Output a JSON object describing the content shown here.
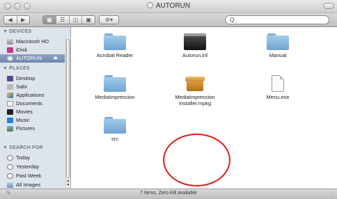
{
  "window": {
    "title": "AUTORUN"
  },
  "toolbar": {
    "back_glyph": "◀",
    "forward_glyph": "▶",
    "view_icon_glyph": "▦",
    "view_list_glyph": "☰",
    "view_column_glyph": "◫",
    "view_coverflow_glyph": "▣",
    "action_glyph": "⚙▾",
    "search_glyph": "Q",
    "search_value": ""
  },
  "sidebar": {
    "devices_header": "▼ DEVICES",
    "places_header": "▼ PLACES",
    "search_header": "▼ SEARCH FOR",
    "devices": [
      {
        "label": "Macintosh HD",
        "icon": "hard-drive-icon"
      },
      {
        "label": "iDisk",
        "icon": "idisk-icon"
      },
      {
        "label": "AUTORUN",
        "icon": "cd-disc-icon",
        "selected": true,
        "eject": "⏏"
      }
    ],
    "places": [
      {
        "label": "Desktop",
        "icon": "desktop-icon"
      },
      {
        "label": "Salix",
        "icon": "home-icon"
      },
      {
        "label": "Applications",
        "icon": "applications-icon"
      },
      {
        "label": "Documents",
        "icon": "documents-icon"
      },
      {
        "label": "Movies",
        "icon": "movies-icon"
      },
      {
        "label": "Music",
        "icon": "music-icon"
      },
      {
        "label": "Pictures",
        "icon": "pictures-icon"
      }
    ],
    "search": [
      {
        "label": "Today",
        "icon": "clock-icon"
      },
      {
        "label": "Yesterday",
        "icon": "clock-icon"
      },
      {
        "label": "Past Week",
        "icon": "clock-icon"
      },
      {
        "label": "All Images",
        "icon": "images-icon"
      }
    ]
  },
  "files": [
    {
      "name": "Acrobat Reader",
      "icon": "folder-icon"
    },
    {
      "name": "Autorun.inf",
      "icon": "terminal-file-icon"
    },
    {
      "name": "Manual",
      "icon": "folder-icon"
    },
    {
      "name": "MediaImpression",
      "icon": "folder-icon"
    },
    {
      "name": "MediaImpression Installer.mpkg",
      "icon": "package-icon"
    },
    {
      "name": "Menu.exe",
      "icon": "document-icon"
    },
    {
      "name": "src",
      "icon": "folder-icon"
    }
  ],
  "status": {
    "text": "7 items, Zero KB available"
  },
  "colors": {
    "annotation_circle": "#e11b1b",
    "selection": "#7a92b4",
    "folder": "#8dbbe0"
  }
}
